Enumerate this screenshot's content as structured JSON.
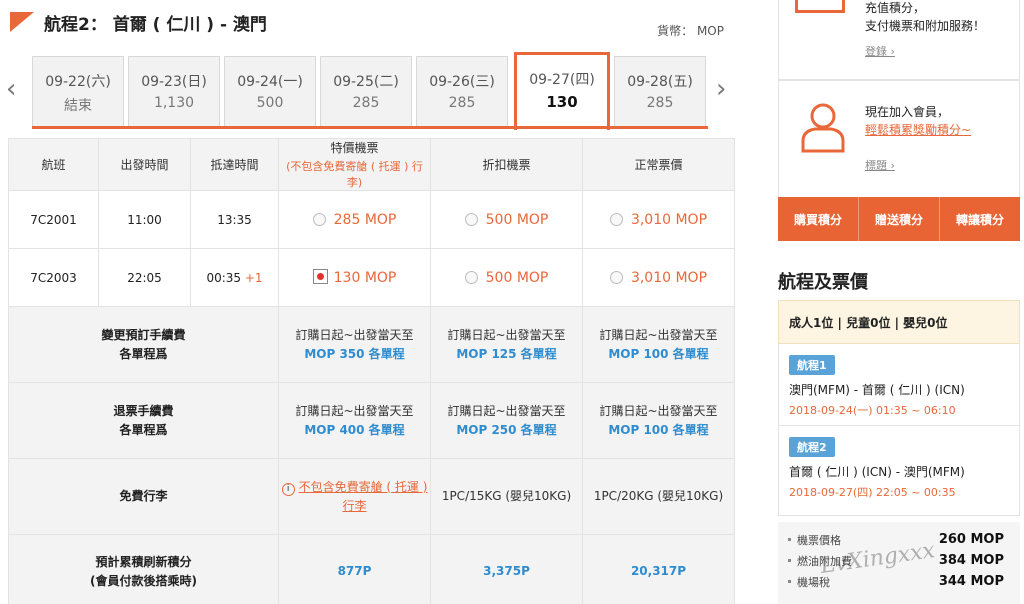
{
  "header": {
    "title": "航程2： 首爾 ( 仁川 ) - 澳門",
    "currency": "貨幣： MOP"
  },
  "dates": [
    {
      "date": "09-22(六)",
      "price": "結束",
      "active": false
    },
    {
      "date": "09-23(日)",
      "price": "1,130",
      "active": false
    },
    {
      "date": "09-24(一)",
      "price": "500",
      "active": false
    },
    {
      "date": "09-25(二)",
      "price": "285",
      "active": false
    },
    {
      "date": "09-26(三)",
      "price": "285",
      "active": false
    },
    {
      "date": "09-27(四)",
      "price": "130",
      "active": true
    },
    {
      "date": "09-28(五)",
      "price": "285",
      "active": false
    }
  ],
  "table": {
    "headers": {
      "flight": "航班",
      "depart": "出發時間",
      "arrive": "抵達時間",
      "special": "特價機票",
      "special_note": "(不包含免費寄艙 ( 托運 ) 行李)",
      "discount": "折扣機票",
      "normal": "正常票價"
    },
    "flights": [
      {
        "code": "7C2001",
        "depart": "11:00",
        "arrive": "13:35",
        "arrive_plus": "",
        "special": "285 MOP",
        "discount": "500 MOP",
        "normal": "3,010 MOP"
      },
      {
        "code": "7C2003",
        "depart": "22:05",
        "arrive": "00:35",
        "arrive_plus": "+1",
        "special": "130 MOP",
        "discount": "500 MOP",
        "normal": "3,010 MOP"
      }
    ],
    "change_fee": {
      "label1": "變更預訂手續費",
      "label2": "各單程爲",
      "period": "訂購日起~出發當天至",
      "special": "MOP 350 各單程",
      "discount": "MOP 125 各單程",
      "normal": "MOP 100 各單程"
    },
    "refund_fee": {
      "label1": "退票手續費",
      "label2": "各單程爲",
      "period": "訂購日起~出發當天至",
      "special": "MOP 400 各單程",
      "discount": "MOP 250 各單程",
      "normal": "MOP 100 各單程"
    },
    "baggage": {
      "label": "免費行李",
      "special1": "不包含免費寄艙 ( 托運 )",
      "special2": "行李",
      "discount": "1PC/15KG (嬰兒10KG)",
      "normal": "1PC/20KG (嬰兒10KG)"
    },
    "points": {
      "label1": "預計累積刷新積分",
      "label2": "(會員付款後搭乘時)",
      "special": "877P",
      "discount": "3,375P",
      "normal": "20,317P"
    }
  },
  "sidebar": {
    "box1_line1": "充值積分，",
    "box1_line2": "支付機票和附加服務！",
    "box1_link": "登錄",
    "box2_line1": "現在加入會員，",
    "box2_line2": "輕鬆積累獎勵積分~",
    "box2_link": "標題",
    "buttons": [
      "購買積分",
      "贈送積分",
      "轉讓積分"
    ],
    "section_title": "航程及票價",
    "passengers": "成人1位 | 兒童0位 | 嬰兒0位",
    "legs": [
      {
        "badge": "航程1",
        "route": "澳門(MFM) - 首爾 ( 仁川 ) (ICN)",
        "time": "2018-09-24(一) 01:35 ~ 06:10"
      },
      {
        "badge": "航程2",
        "route": "首爾 ( 仁川 ) (ICN) - 澳門(MFM)",
        "time": "2018-09-27(四) 22:05 ~ 00:35"
      }
    ],
    "prices": [
      {
        "label": "機票價格",
        "amount": "260 MOP"
      },
      {
        "label": "燃油附加費",
        "amount": "384 MOP"
      },
      {
        "label": "機場稅",
        "amount": "344 MOP"
      }
    ],
    "watermark": "LvXingxxx"
  },
  "colors": {
    "accent": "#e8683a",
    "blue": "#2f8ccf",
    "badge": "#5aa3d8"
  }
}
